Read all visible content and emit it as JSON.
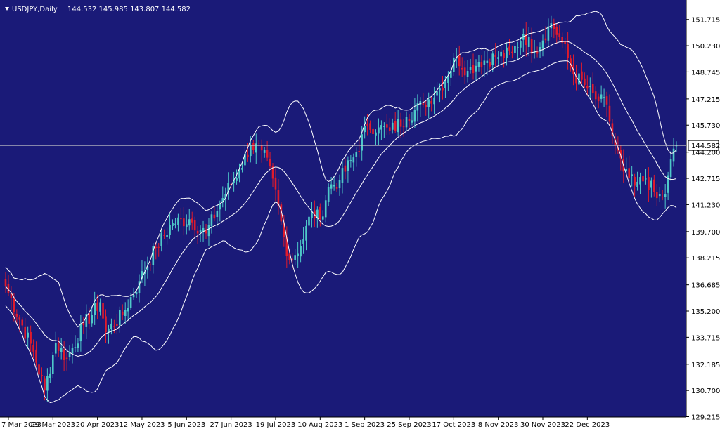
{
  "header": {
    "symbol": "USDJPY,Daily",
    "ohlc": "144.532 145.985 143.807 144.582"
  },
  "current_price": "144.582",
  "colors": {
    "background": "#1a1a78",
    "bull": "#4ec9c9",
    "bear": "#e01b2c",
    "bands": "#ffffff",
    "price_line": "#c8c8c8"
  },
  "chart_data": {
    "type": "candlestick",
    "overlay": "Bollinger Bands",
    "ylim": [
      129.275,
      152.5
    ],
    "y_ticks": [
      "151.715",
      "150.230",
      "148.745",
      "147.215",
      "145.730",
      "144.200",
      "142.715",
      "141.230",
      "139.700",
      "138.215",
      "136.685",
      "135.200",
      "133.715",
      "132.185",
      "130.700",
      "129.215"
    ],
    "x_ticks": [
      "7 Mar 2023",
      "29 Mar 2023",
      "20 Apr 2023",
      "12 May 2023",
      "5 Jun 2023",
      "27 Jun 2023",
      "19 Jul 2023",
      "10 Aug 2023",
      "1 Sep 2023",
      "25 Sep 2023",
      "17 Oct 2023",
      "8 Nov 2023",
      "30 Nov 2023",
      "22 Dec 2023"
    ],
    "trajectory": [
      {
        "i": 0,
        "p": 136.6
      },
      {
        "i": 10,
        "p": 132.9
      },
      {
        "i": 14,
        "p": 130.7
      },
      {
        "i": 18,
        "p": 133.4
      },
      {
        "i": 22,
        "p": 132.5
      },
      {
        "i": 28,
        "p": 134.4
      },
      {
        "i": 34,
        "p": 135.7
      },
      {
        "i": 36,
        "p": 134.0
      },
      {
        "i": 42,
        "p": 135.0
      },
      {
        "i": 48,
        "p": 136.9
      },
      {
        "i": 54,
        "p": 138.8
      },
      {
        "i": 60,
        "p": 140.2
      },
      {
        "i": 66,
        "p": 140.4
      },
      {
        "i": 72,
        "p": 139.6
      },
      {
        "i": 78,
        "p": 141.6
      },
      {
        "i": 84,
        "p": 143.2
      },
      {
        "i": 88,
        "p": 144.6
      },
      {
        "i": 92,
        "p": 144.3
      },
      {
        "i": 96,
        "p": 142.7
      },
      {
        "i": 100,
        "p": 139.4
      },
      {
        "i": 102,
        "p": 138.1
      },
      {
        "i": 106,
        "p": 138.9
      },
      {
        "i": 110,
        "p": 140.8
      },
      {
        "i": 113,
        "p": 140.4
      },
      {
        "i": 116,
        "p": 142.2
      },
      {
        "i": 120,
        "p": 142.6
      },
      {
        "i": 126,
        "p": 144.2
      },
      {
        "i": 130,
        "p": 145.7
      },
      {
        "i": 134,
        "p": 145.6
      },
      {
        "i": 138,
        "p": 145.4
      },
      {
        "i": 144,
        "p": 146.2
      },
      {
        "i": 150,
        "p": 146.9
      },
      {
        "i": 156,
        "p": 147.8
      },
      {
        "i": 162,
        "p": 149.6
      },
      {
        "i": 166,
        "p": 148.8
      },
      {
        "i": 170,
        "p": 149.3
      },
      {
        "i": 176,
        "p": 149.6
      },
      {
        "i": 182,
        "p": 149.8
      },
      {
        "i": 186,
        "p": 150.9
      },
      {
        "i": 190,
        "p": 149.9
      },
      {
        "i": 196,
        "p": 151.5
      },
      {
        "i": 200,
        "p": 150.4
      },
      {
        "i": 204,
        "p": 148.6
      },
      {
        "i": 208,
        "p": 148.0
      },
      {
        "i": 212,
        "p": 147.2
      },
      {
        "i": 216,
        "p": 146.9
      },
      {
        "i": 218,
        "p": 145.1
      },
      {
        "i": 222,
        "p": 143.1
      },
      {
        "i": 226,
        "p": 142.3
      },
      {
        "i": 230,
        "p": 142.7
      },
      {
        "i": 234,
        "p": 141.6
      },
      {
        "i": 237,
        "p": 141.8
      },
      {
        "i": 240,
        "p": 144.4
      },
      {
        "i": 241,
        "p": 144.582
      }
    ]
  }
}
